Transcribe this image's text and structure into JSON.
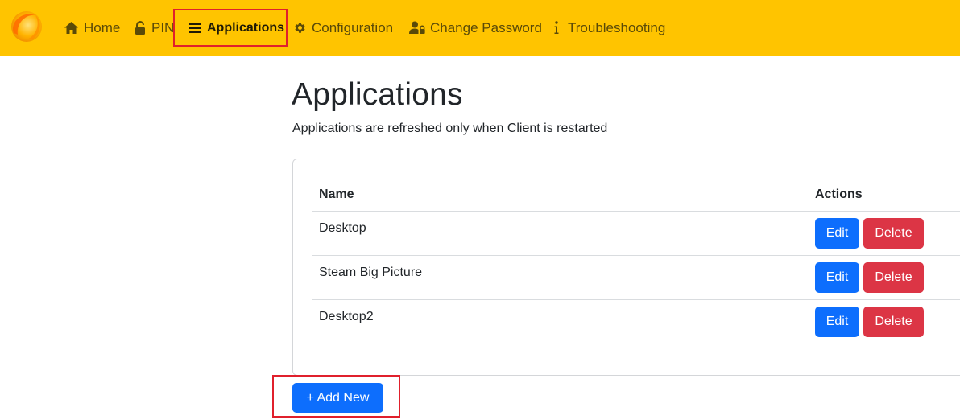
{
  "nav": {
    "logo_icon": "sunshine-logo-icon",
    "items": [
      {
        "label": "Home",
        "icon": "home-icon"
      },
      {
        "label": "PIN",
        "icon": "unlock-icon"
      },
      {
        "label": "Applications",
        "icon": "list-icon",
        "active": true
      },
      {
        "label": "Configuration",
        "icon": "gear-icon"
      },
      {
        "label": "Change Password",
        "icon": "user-lock-icon"
      },
      {
        "label": "Troubleshooting",
        "icon": "info-icon"
      }
    ],
    "bar_color": "#ffc400"
  },
  "main": {
    "title": "Applications",
    "subtitle": "Applications are refreshed only when Client is restarted",
    "table": {
      "columns": [
        "Name",
        "Actions"
      ],
      "rows": [
        {
          "name": "Desktop"
        },
        {
          "name": "Steam Big Picture"
        },
        {
          "name": "Desktop2"
        }
      ],
      "edit_label": "Edit",
      "delete_label": "Delete"
    },
    "add_button": {
      "icon": "plus",
      "label": "+ Add New"
    }
  },
  "colors": {
    "primary": "#0d6efd",
    "danger": "#dc3545",
    "highlight": "#e0202c"
  }
}
